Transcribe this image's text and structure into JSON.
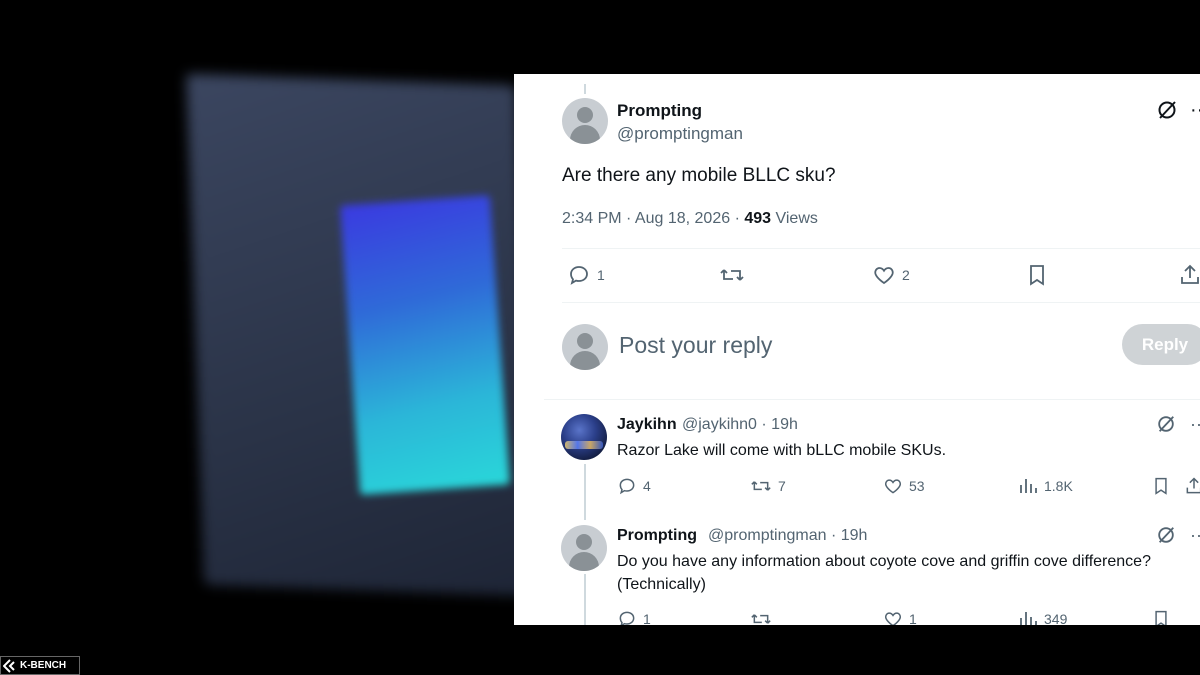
{
  "post": {
    "name": "Prompting",
    "handle": "@promptingman",
    "text": "Are there any mobile BLLC sku?",
    "time": "2:34 PM · Aug 18, 2026 · ",
    "views_count": "493",
    "views_label": " Views",
    "replies": "1",
    "likes": "2"
  },
  "composer": {
    "placeholder": "Post your reply",
    "button": "Reply"
  },
  "replies": [
    {
      "name": "Jaykihn",
      "handle": "@jaykihn0 · 19h",
      "text": "Razor Lake will come with bLLC mobile SKUs.",
      "replies": "4",
      "reposts": "7",
      "likes": "53",
      "views": "1.8K"
    },
    {
      "name": "Prompting",
      "handle": "@promptingman · 19h",
      "text_line1": "Do you have any information about coyote cove and griffin cove difference?",
      "text_line2": "(Technically)",
      "replies": "1",
      "likes": "1",
      "views": "349"
    }
  ],
  "watermark": "K-BENCH",
  "colors": {
    "accent_text": "#0f1419",
    "secondary_text": "#536471",
    "reply_button_disabled": "#cfd3d6",
    "divider": "#eff3f4"
  },
  "icons": [
    "grok-icon",
    "more-icon",
    "reply-icon",
    "repost-icon",
    "like-icon",
    "bookmark-icon",
    "share-icon",
    "views-icon"
  ]
}
